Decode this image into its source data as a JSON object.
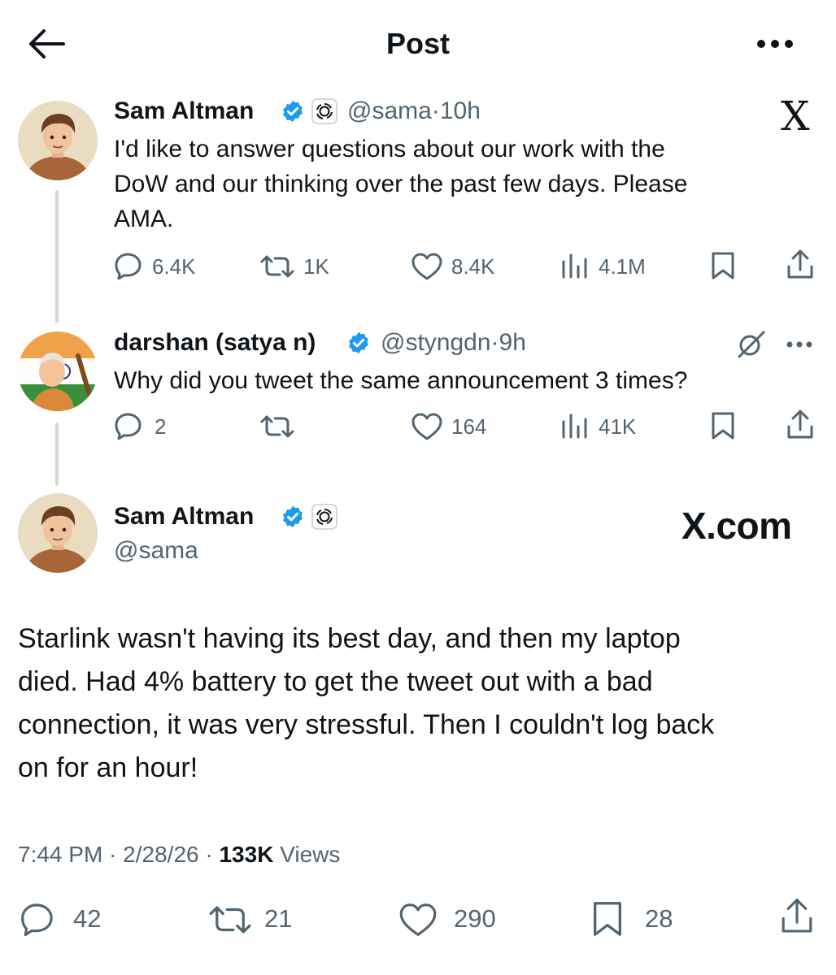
{
  "header": {
    "title": "Post"
  },
  "tweet1": {
    "name": "Sam Altman",
    "handle": "@sama",
    "sep": "·",
    "time": "10h",
    "text_lines": [
      "I'd like to answer questions about our work with the",
      "DoW and our thinking over the past few days. Please",
      "AMA."
    ],
    "stats": {
      "replies": "6.4K",
      "reposts": "1K",
      "likes": "8.4K",
      "views": "4.1M"
    }
  },
  "tweet2": {
    "name": "darshan (satya n)",
    "handle": "@styngdn",
    "sep": "·",
    "time": "9h",
    "text": "Why did you tweet the same announcement 3 times?",
    "stats": {
      "replies": "2",
      "reposts": "",
      "likes": "164",
      "views": "41K"
    }
  },
  "main": {
    "name": "Sam Altman",
    "handle": "@sama",
    "text_lines": [
      "Starlink wasn't having its best day, and then my laptop",
      "died. Had 4% battery to get the tweet out with a bad",
      "connection, it was very stressful. Then I couldn't log back",
      "on for an hour!"
    ],
    "time": "7:44 PM",
    "date": "2/28/26",
    "sep": "·",
    "views_count": "133K",
    "views_label": "Views",
    "stats": {
      "replies": "42",
      "reposts": "21",
      "likes": "290",
      "bookmarks": "28"
    }
  },
  "watermark": {
    "corner": "X",
    "big_text": "X.com"
  },
  "colors": {
    "text": "#0f1419",
    "secondary": "#536471",
    "verified": "#1d9bf0",
    "line": "#cfd9de"
  }
}
